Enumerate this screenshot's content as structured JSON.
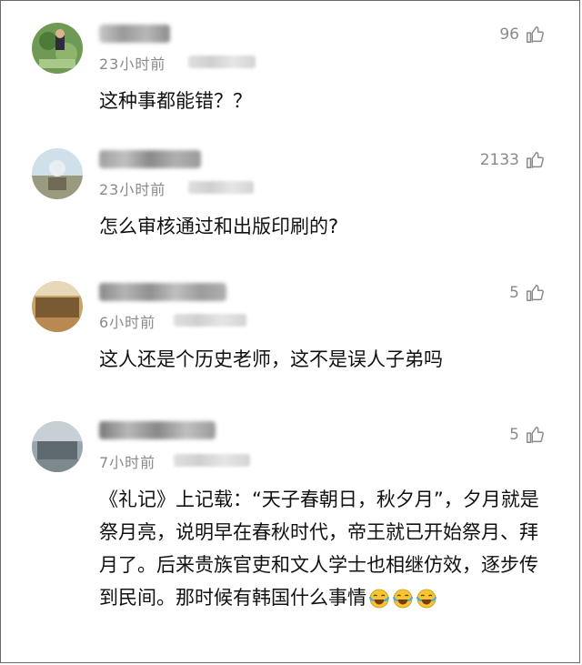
{
  "comments": [
    {
      "time": "23小时前",
      "likes": "96",
      "text": "这种事都能错？？"
    },
    {
      "time": "23小时前",
      "likes": "2133",
      "text": "怎么审核通过和出版印刷的?"
    },
    {
      "time": "6小时前",
      "likes": "5",
      "text": "这人还是个历史老师，这不是误人子弟吗"
    },
    {
      "time": "7小时前",
      "likes": "5",
      "text": "《礼记》上记载：“天子春朝日，秋夕月”，夕月就是祭月亮，说明早在春秋时代，帝王就已开始祭月、拜月了。后来贵族官吏和文人学士也相继仿效，逐步传到民间。那时候有韩国什么事情",
      "emoji_count": 3,
      "emoji_icon": "laughing-crying-emoji"
    }
  ],
  "icons": {
    "like": "thumbs-up-icon"
  },
  "colors": {
    "meta": "#8a8a8a",
    "text": "#111111",
    "border": "#6a6a6a"
  }
}
